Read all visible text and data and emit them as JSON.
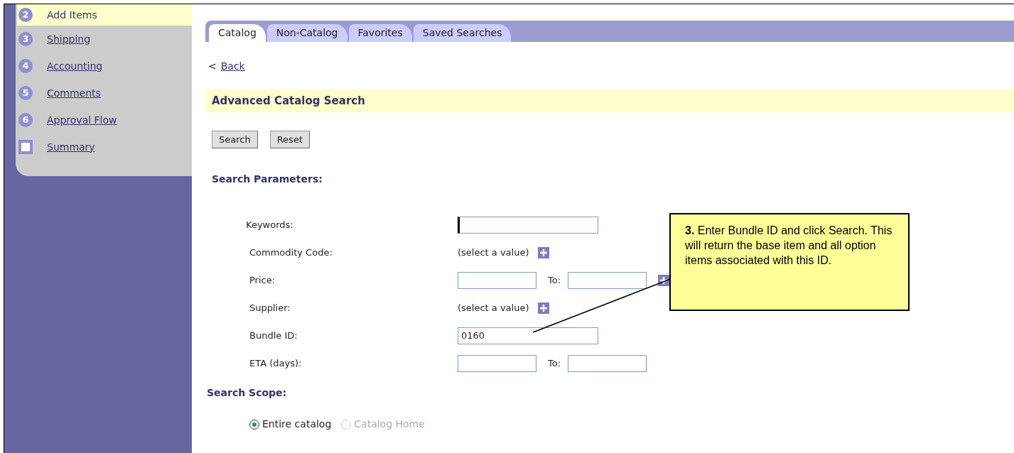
{
  "steps": [
    {
      "marker": "2",
      "label": "Add Items",
      "kind": "number",
      "selected": true
    },
    {
      "marker": "3",
      "label": "Shipping",
      "kind": "number",
      "selected": false
    },
    {
      "marker": "4",
      "label": "Accounting",
      "kind": "number",
      "selected": false
    },
    {
      "marker": "5",
      "label": "Comments",
      "kind": "number",
      "selected": false
    },
    {
      "marker": "6",
      "label": "Approval Flow",
      "kind": "number",
      "selected": false
    },
    {
      "label": "Summary",
      "kind": "square",
      "selected": false
    }
  ],
  "tabs": [
    {
      "label": "Catalog",
      "selected": true
    },
    {
      "label": "Non-Catalog",
      "selected": false
    },
    {
      "label": "Favorites",
      "selected": false
    },
    {
      "label": "Saved Searches",
      "selected": false
    }
  ],
  "back_link": {
    "arrow": "<",
    "label": "Back"
  },
  "section_title": "Advanced Catalog Search",
  "buttons": [
    "Search",
    "Reset"
  ],
  "parameters_heading": "Search Parameters:",
  "fields": [
    {
      "kind": "text",
      "label": "Keywords:",
      "focused": true
    },
    {
      "kind": "select",
      "label": "Commodity Code:",
      "value": "(select a value)"
    },
    {
      "kind": "range",
      "label": "Price:",
      "to_label": "To:",
      "picker": true
    },
    {
      "kind": "select",
      "label": "Supplier:",
      "value": "(select a value)"
    },
    {
      "kind": "text",
      "label": "Bundle ID:",
      "value": "0160",
      "focused": false
    },
    {
      "kind": "range",
      "label": "ETA (days):",
      "to_label": "To:",
      "picker": false
    }
  ],
  "scope_heading": "Search Scope:",
  "scope_options": [
    {
      "label": "Entire catalog",
      "selected": true,
      "disabled": false
    },
    {
      "label": "Catalog Home",
      "selected": false,
      "disabled": true
    }
  ],
  "callout": "**3.** Enter Bundle ID and click Search.  This will return the base item and all option items associated with this ID."
}
